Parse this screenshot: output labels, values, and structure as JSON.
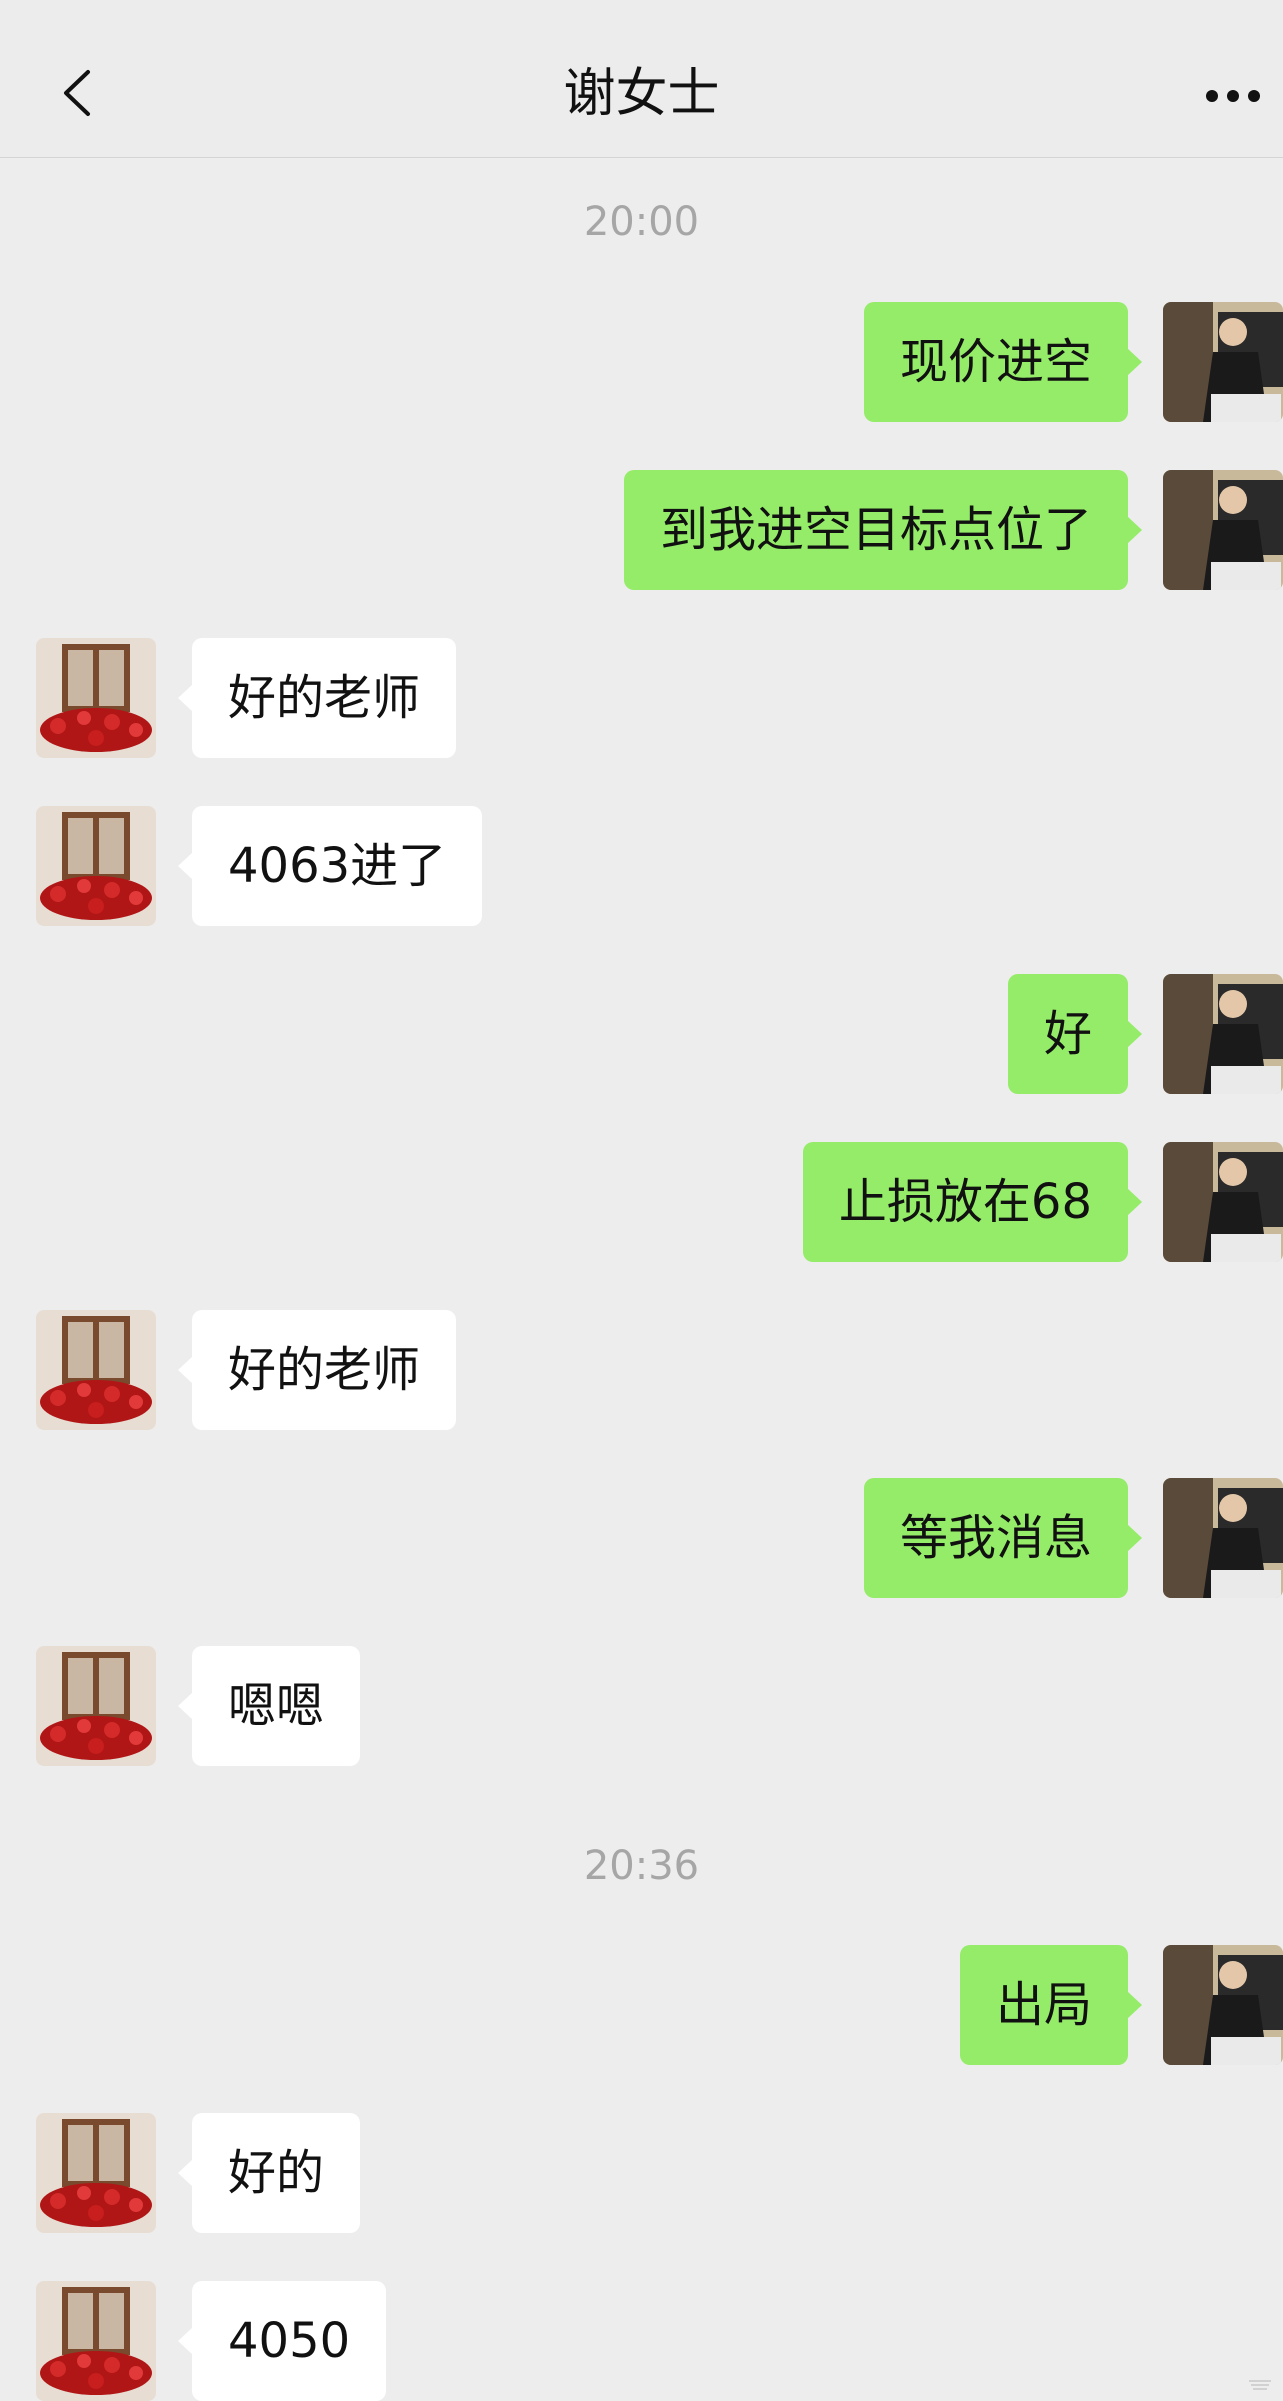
{
  "header": {
    "title": "谢女士"
  },
  "icons": {
    "back": "chevron-left-icon",
    "more": "more-dots-icon"
  },
  "colors": {
    "background": "#ededed",
    "sent_bubble": "#95ec69",
    "received_bubble": "#ffffff",
    "timestamp_text": "#a6a6a6"
  },
  "chat": {
    "timestamps": [
      "20:00",
      "20:36"
    ],
    "messages": [
      {
        "side": "sent",
        "text": "现价进空"
      },
      {
        "side": "sent",
        "text": "到我进空目标点位了"
      },
      {
        "side": "received",
        "text": "好的老师"
      },
      {
        "side": "received",
        "text": "4063进了"
      },
      {
        "side": "sent",
        "text": "好"
      },
      {
        "side": "sent",
        "text": "止损放在68"
      },
      {
        "side": "received",
        "text": "好的老师"
      },
      {
        "side": "sent",
        "text": "等我消息"
      },
      {
        "side": "received",
        "text": "嗯嗯"
      },
      {
        "side": "sent",
        "text": "出局"
      },
      {
        "side": "received",
        "text": "好的"
      },
      {
        "side": "received",
        "text": "4050"
      }
    ]
  }
}
